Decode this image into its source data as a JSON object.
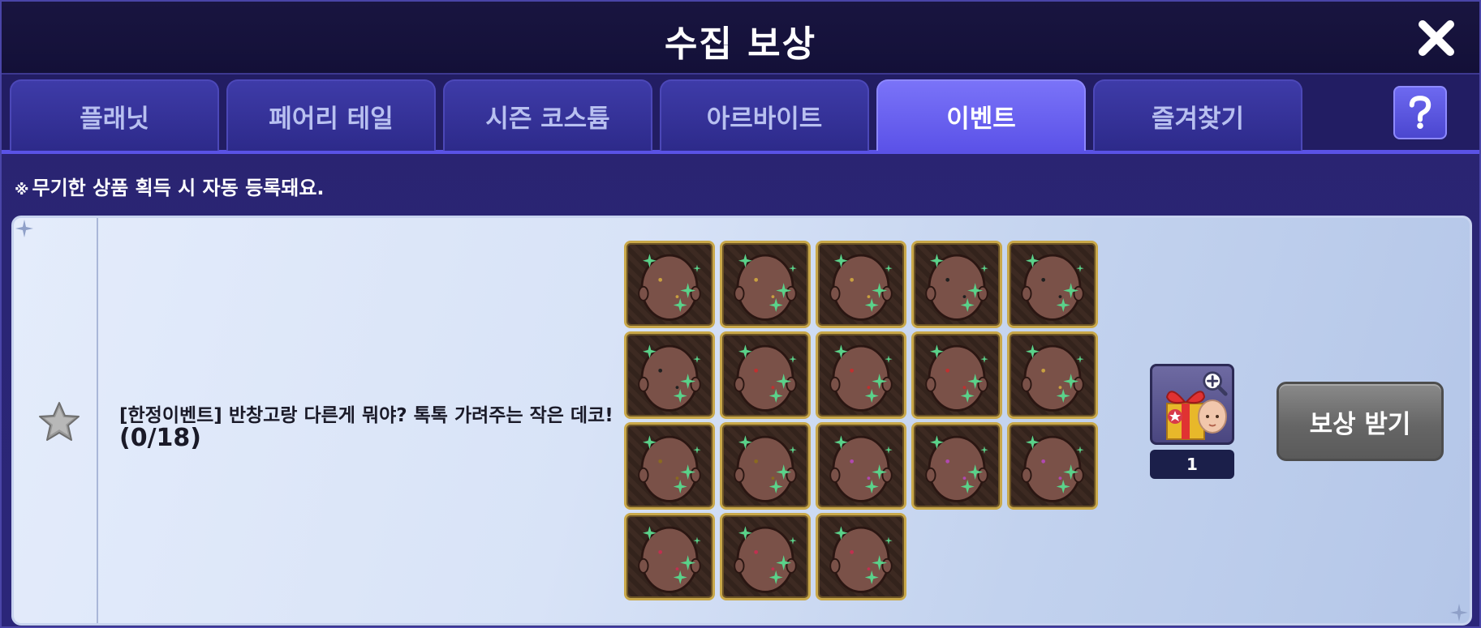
{
  "window": {
    "title": "수집 보상"
  },
  "tabs": [
    {
      "label": "플래닛"
    },
    {
      "label": "페어리 테일"
    },
    {
      "label": "시즌 코스튬"
    },
    {
      "label": "아르바이트"
    },
    {
      "label": "이벤트",
      "active": true
    },
    {
      "label": "즐겨찾기"
    }
  ],
  "notice": {
    "mark": "※",
    "text": "무기한 상품 획득 시 자동 등록돼요."
  },
  "mission": {
    "title": "[한정이벤트] 반창고랑 다른게 뭐야? 톡톡 가려주는 작은 데코!",
    "progress": "(0/18)",
    "item_count": 18
  },
  "reward": {
    "count": "1",
    "claim_label": "보상 받기"
  },
  "icons": {
    "close": "close-icon",
    "help": "question-mark-icon",
    "favorite": "star-icon",
    "reward": "gift-box-icon",
    "zoom": "magnifier-plus-icon"
  },
  "colors": {
    "active_tab": "#6a62f2",
    "tab": "#3a37a0",
    "claim_button": "#707070",
    "item_frame": "#c9a84a"
  }
}
